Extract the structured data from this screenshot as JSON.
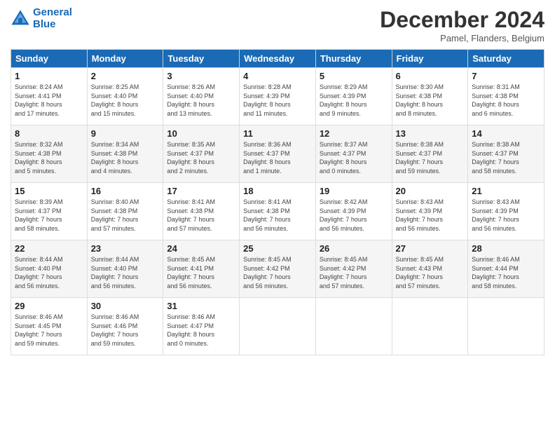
{
  "header": {
    "logo_line1": "General",
    "logo_line2": "Blue",
    "month": "December 2024",
    "location": "Pamel, Flanders, Belgium"
  },
  "days_of_week": [
    "Sunday",
    "Monday",
    "Tuesday",
    "Wednesday",
    "Thursday",
    "Friday",
    "Saturday"
  ],
  "weeks": [
    [
      {
        "day": "1",
        "info": "Sunrise: 8:24 AM\nSunset: 4:41 PM\nDaylight: 8 hours\nand 17 minutes."
      },
      {
        "day": "2",
        "info": "Sunrise: 8:25 AM\nSunset: 4:40 PM\nDaylight: 8 hours\nand 15 minutes."
      },
      {
        "day": "3",
        "info": "Sunrise: 8:26 AM\nSunset: 4:40 PM\nDaylight: 8 hours\nand 13 minutes."
      },
      {
        "day": "4",
        "info": "Sunrise: 8:28 AM\nSunset: 4:39 PM\nDaylight: 8 hours\nand 11 minutes."
      },
      {
        "day": "5",
        "info": "Sunrise: 8:29 AM\nSunset: 4:39 PM\nDaylight: 8 hours\nand 9 minutes."
      },
      {
        "day": "6",
        "info": "Sunrise: 8:30 AM\nSunset: 4:38 PM\nDaylight: 8 hours\nand 8 minutes."
      },
      {
        "day": "7",
        "info": "Sunrise: 8:31 AM\nSunset: 4:38 PM\nDaylight: 8 hours\nand 6 minutes."
      }
    ],
    [
      {
        "day": "8",
        "info": "Sunrise: 8:32 AM\nSunset: 4:38 PM\nDaylight: 8 hours\nand 5 minutes."
      },
      {
        "day": "9",
        "info": "Sunrise: 8:34 AM\nSunset: 4:38 PM\nDaylight: 8 hours\nand 4 minutes."
      },
      {
        "day": "10",
        "info": "Sunrise: 8:35 AM\nSunset: 4:37 PM\nDaylight: 8 hours\nand 2 minutes."
      },
      {
        "day": "11",
        "info": "Sunrise: 8:36 AM\nSunset: 4:37 PM\nDaylight: 8 hours\nand 1 minute."
      },
      {
        "day": "12",
        "info": "Sunrise: 8:37 AM\nSunset: 4:37 PM\nDaylight: 8 hours\nand 0 minutes."
      },
      {
        "day": "13",
        "info": "Sunrise: 8:38 AM\nSunset: 4:37 PM\nDaylight: 7 hours\nand 59 minutes."
      },
      {
        "day": "14",
        "info": "Sunrise: 8:38 AM\nSunset: 4:37 PM\nDaylight: 7 hours\nand 58 minutes."
      }
    ],
    [
      {
        "day": "15",
        "info": "Sunrise: 8:39 AM\nSunset: 4:37 PM\nDaylight: 7 hours\nand 58 minutes."
      },
      {
        "day": "16",
        "info": "Sunrise: 8:40 AM\nSunset: 4:38 PM\nDaylight: 7 hours\nand 57 minutes."
      },
      {
        "day": "17",
        "info": "Sunrise: 8:41 AM\nSunset: 4:38 PM\nDaylight: 7 hours\nand 57 minutes."
      },
      {
        "day": "18",
        "info": "Sunrise: 8:41 AM\nSunset: 4:38 PM\nDaylight: 7 hours\nand 56 minutes."
      },
      {
        "day": "19",
        "info": "Sunrise: 8:42 AM\nSunset: 4:39 PM\nDaylight: 7 hours\nand 56 minutes."
      },
      {
        "day": "20",
        "info": "Sunrise: 8:43 AM\nSunset: 4:39 PM\nDaylight: 7 hours\nand 56 minutes."
      },
      {
        "day": "21",
        "info": "Sunrise: 8:43 AM\nSunset: 4:39 PM\nDaylight: 7 hours\nand 56 minutes."
      }
    ],
    [
      {
        "day": "22",
        "info": "Sunrise: 8:44 AM\nSunset: 4:40 PM\nDaylight: 7 hours\nand 56 minutes."
      },
      {
        "day": "23",
        "info": "Sunrise: 8:44 AM\nSunset: 4:40 PM\nDaylight: 7 hours\nand 56 minutes."
      },
      {
        "day": "24",
        "info": "Sunrise: 8:45 AM\nSunset: 4:41 PM\nDaylight: 7 hours\nand 56 minutes."
      },
      {
        "day": "25",
        "info": "Sunrise: 8:45 AM\nSunset: 4:42 PM\nDaylight: 7 hours\nand 56 minutes."
      },
      {
        "day": "26",
        "info": "Sunrise: 8:45 AM\nSunset: 4:42 PM\nDaylight: 7 hours\nand 57 minutes."
      },
      {
        "day": "27",
        "info": "Sunrise: 8:45 AM\nSunset: 4:43 PM\nDaylight: 7 hours\nand 57 minutes."
      },
      {
        "day": "28",
        "info": "Sunrise: 8:46 AM\nSunset: 4:44 PM\nDaylight: 7 hours\nand 58 minutes."
      }
    ],
    [
      {
        "day": "29",
        "info": "Sunrise: 8:46 AM\nSunset: 4:45 PM\nDaylight: 7 hours\nand 59 minutes."
      },
      {
        "day": "30",
        "info": "Sunrise: 8:46 AM\nSunset: 4:46 PM\nDaylight: 7 hours\nand 59 minutes."
      },
      {
        "day": "31",
        "info": "Sunrise: 8:46 AM\nSunset: 4:47 PM\nDaylight: 8 hours\nand 0 minutes."
      },
      {
        "day": "",
        "info": ""
      },
      {
        "day": "",
        "info": ""
      },
      {
        "day": "",
        "info": ""
      },
      {
        "day": "",
        "info": ""
      }
    ]
  ]
}
